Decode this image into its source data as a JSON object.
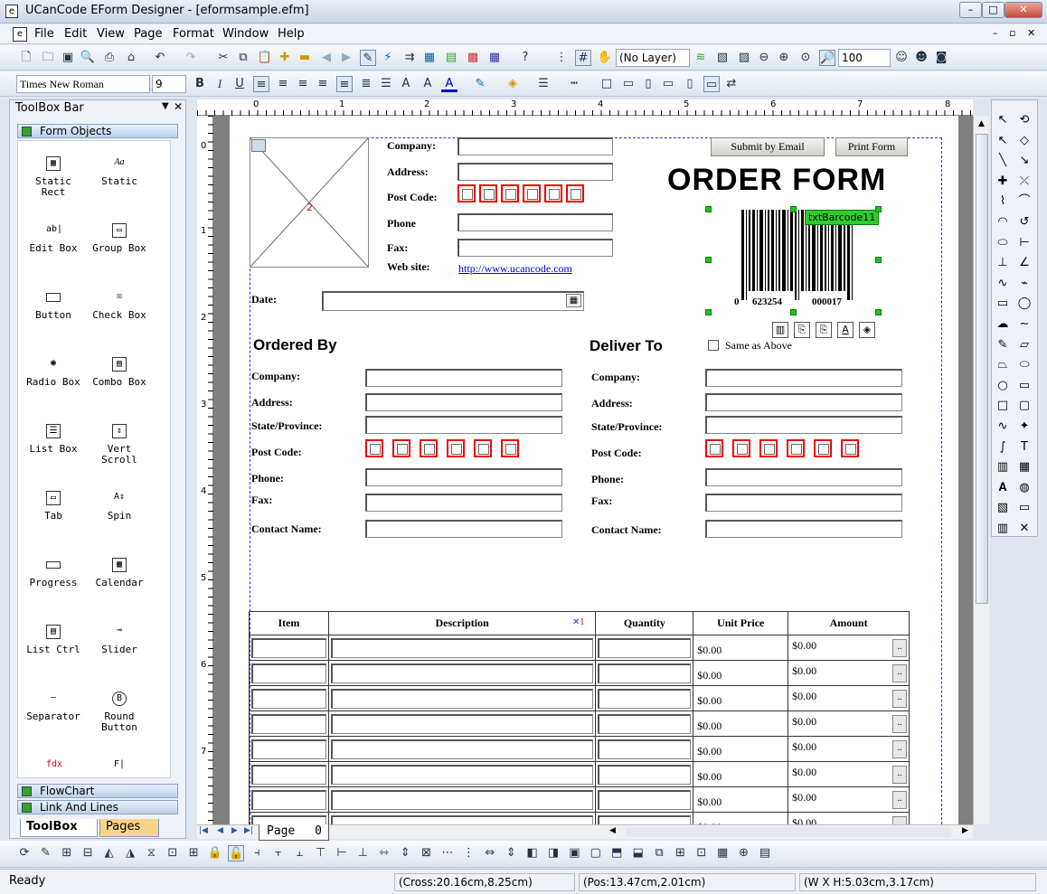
{
  "window": {
    "title": "UCanCode EForm Designer - [eformsample.efm]",
    "app_icon_glyph": "e"
  },
  "menu": [
    "File",
    "Edit",
    "View",
    "Page",
    "Format",
    "Window",
    "Help"
  ],
  "toolbar1": {
    "layer_value": "(No Layer)",
    "zoom_value": "100"
  },
  "toolbar2": {
    "font_value": "Times New Roman",
    "size_value": "9"
  },
  "toolbox": {
    "title": "ToolBox Bar",
    "group_form_objects": "Form Objects",
    "tools": [
      "Static Rect",
      "Static",
      "Edit Box",
      "Group Box",
      "Button",
      "Check Box",
      "Radio Box",
      "Combo Box",
      "List Box",
      "Vert Scroll",
      "Tab",
      "Spin",
      "Progress",
      "Calendar",
      "List Ctrl",
      "Slider",
      "Separator",
      "Round Button"
    ],
    "group_flowchart": "FlowChart",
    "group_link_lines": "Link And Lines",
    "tab_toolbox": "ToolBox",
    "tab_pages": "Pages"
  },
  "ruler": {
    "h": [
      "0",
      "1",
      "2",
      "3",
      "4",
      "5",
      "6",
      "7",
      "8"
    ],
    "v": [
      "0",
      "1",
      "2",
      "3",
      "4",
      "5",
      "6",
      "7"
    ]
  },
  "form": {
    "company_label": "Company:",
    "address_label": "Address:",
    "postcode_label": "Post Code:",
    "phone_label": "Phone",
    "fax_label": "Fax:",
    "website_label": "Web site:",
    "website_link": "http://www.ucancode.com",
    "date_label": "Date:",
    "submit_email": "Submit by Email",
    "print_form": "Print Form",
    "title": "ORDER FORM",
    "barcode_tag": "txtBarcode11",
    "barcode_digits_left": "0",
    "barcode_digits_mid": "623254",
    "barcode_digits_right": "000017",
    "image_number": "2",
    "ordered_by": "Ordered By",
    "deliver_to": "Deliver To",
    "same_as_above": "Same as Above",
    "ob": {
      "company": "Company:",
      "address": "Address:",
      "state": "State/Province:",
      "postcode": "Post Code:",
      "phone": "Phone:",
      "fax": "Fax:",
      "contact": "Contact Name:"
    },
    "dt": {
      "company": "Company:",
      "address": "Address:",
      "state": "State/Province:",
      "postcode": "Post Code:",
      "phone": "Phone:",
      "fax": "Fax:",
      "contact": "Contact Name:"
    },
    "table_headers": [
      "Item",
      "Description",
      "Quantity",
      "Unit Price",
      "Amount"
    ],
    "zero_value": "$0.00",
    "desc_marker": "1"
  },
  "pagebar": {
    "label": "Page",
    "number": "0"
  },
  "status": {
    "ready": "Ready",
    "cross": "(Cross:20.16cm,8.25cm)",
    "pos": "(Pos:13.47cm,2.01cm)",
    "size": "(W X H:5.03cm,3.17cm)"
  }
}
